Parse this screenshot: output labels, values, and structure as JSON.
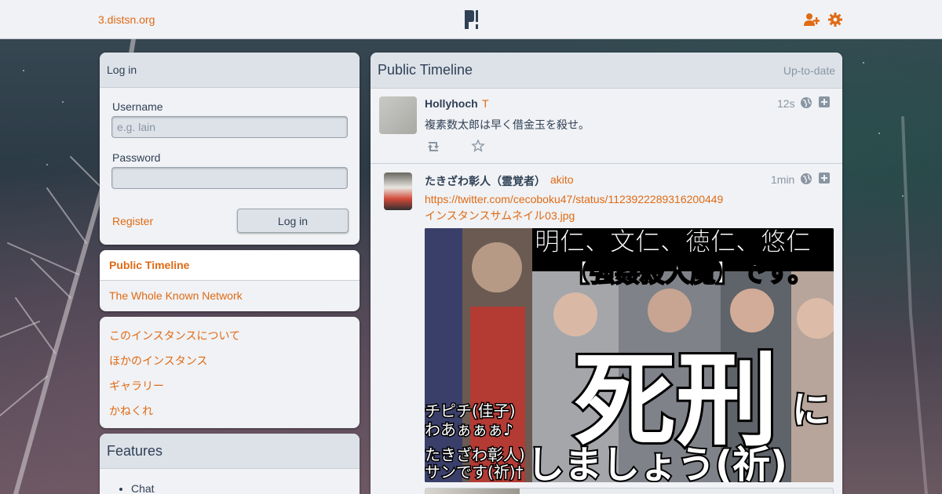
{
  "topnav": {
    "site": "3.distsn.org",
    "icons": [
      "logo-icon",
      "user-plus-icon",
      "gear-icon"
    ]
  },
  "login": {
    "title": "Log in",
    "username_label": "Username",
    "username_placeholder": "e.g. lain",
    "username_value": "",
    "password_label": "Password",
    "password_value": "",
    "register_label": "Register",
    "submit_label": "Log in"
  },
  "nav": {
    "items": [
      {
        "label": "Public Timeline",
        "active": true
      },
      {
        "label": "The Whole Known Network",
        "active": false
      }
    ]
  },
  "instance_links": [
    "このインスタンスについて",
    "ほかのインスタンス",
    "ギャラリー",
    "かねくれ"
  ],
  "features": {
    "title": "Features",
    "items": [
      "Chat"
    ]
  },
  "timeline": {
    "title": "Public Timeline",
    "status": "Up-to-date",
    "statuses": [
      {
        "display_name": "Hollyhoch",
        "handle": "T",
        "time": "12s",
        "content": "複素数太郎は早く借金玉を殺せ。"
      },
      {
        "display_name": "たきざわ彰人（霊覚者）",
        "handle": "akito",
        "time": "1min",
        "link": "https://twitter.com/cecoboku47/status/1123922289316200449",
        "file": "インスタンスサムネイル03.jpg",
        "image_text": {
          "top_line1": "明仁、文仁、徳仁、悠仁",
          "top_line2": "【強姦殺人魔】です。",
          "big": "死刑",
          "big_suffix": "に",
          "bottom": "しましょう(祈)",
          "left1": "チピチ(佳子)",
          "left2": "わあぁぁぁ♪",
          "left3": "たきざわ彰人)",
          "left4": "サンです(祈)†"
        }
      }
    ]
  },
  "colors": {
    "accent": "#e06a14",
    "panel": "#f0f2f5",
    "heading": "#dde2e9",
    "text": "#304055"
  }
}
